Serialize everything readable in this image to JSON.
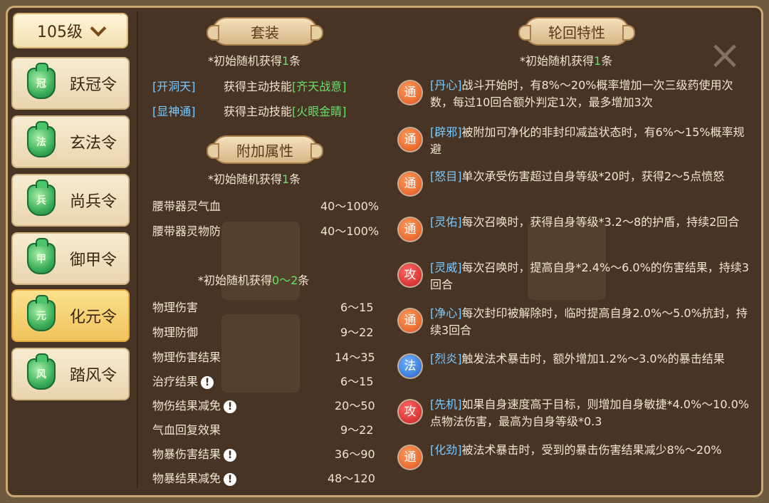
{
  "level_select": {
    "value": "105级"
  },
  "tokens": [
    {
      "label": "跃冠令",
      "glyph": "冠",
      "selected": false
    },
    {
      "label": "玄法令",
      "glyph": "法",
      "selected": false
    },
    {
      "label": "尚兵令",
      "glyph": "兵",
      "selected": false
    },
    {
      "label": "御甲令",
      "glyph": "甲",
      "selected": false
    },
    {
      "label": "化元令",
      "glyph": "元",
      "selected": true
    },
    {
      "label": "踏风令",
      "glyph": "风",
      "selected": false
    }
  ],
  "set": {
    "title": "套装",
    "note_prefix": "*初始随机获得",
    "note_count": "1",
    "note_suffix": "条",
    "rows": [
      {
        "tag": "[开洞天]",
        "desc": "获得主动技能",
        "skill": "[齐天战意]"
      },
      {
        "tag": "[显神通]",
        "desc": "获得主动技能",
        "skill": "[火眼金睛]"
      }
    ]
  },
  "extra": {
    "title": "附加属性",
    "note_prefix": "*初始随机获得",
    "note_count": "1",
    "note_suffix": "条",
    "rows": [
      {
        "name": "腰带器灵气血",
        "range": "40～100%"
      },
      {
        "name": "腰带器灵物防",
        "range": "40～100%"
      }
    ]
  },
  "random": {
    "note_prefix": "*初始随机获得",
    "note_count": "0～2",
    "note_suffix": "条",
    "rows": [
      {
        "name": "物理伤害",
        "range": "6～15",
        "warn": false
      },
      {
        "name": "物理防御",
        "range": "9～22",
        "warn": false
      },
      {
        "name": "物理伤害结果",
        "range": "14～35",
        "warn": false
      },
      {
        "name": "治疗结果",
        "range": "6～15",
        "warn": true
      },
      {
        "name": "物伤结果减免",
        "range": "20～50",
        "warn": true
      },
      {
        "name": "气血回复效果",
        "range": "9～22",
        "warn": false
      },
      {
        "name": "物暴伤害结果",
        "range": "36～90",
        "warn": true
      },
      {
        "name": "物暴结果减免",
        "range": "48～120",
        "warn": true
      }
    ]
  },
  "rebirth": {
    "title": "轮回特性",
    "note_prefix": "*初始随机获得",
    "note_count": "1",
    "note_suffix": "条",
    "traits": [
      {
        "badge": "通",
        "color": "orange",
        "name": "[丹心]",
        "text": "战斗开始时，有8%～20%概率增加一次三级药使用次数，每过10回合额外判定1次，最多增加3次"
      },
      {
        "badge": "通",
        "color": "orange",
        "name": "[辟邪]",
        "text": "被附加可净化的非封印减益状态时，有6%～15%概率规避"
      },
      {
        "badge": "通",
        "color": "orange",
        "name": "[怒目]",
        "text": "单次承受伤害超过自身等级*20时，获得2～5点愤怒"
      },
      {
        "badge": "通",
        "color": "orange",
        "name": "[灵佑]",
        "text": "每次召唤时，获得自身等级*3.2～8的护盾，持续2回合"
      },
      {
        "badge": "攻",
        "color": "red",
        "name": "[灵威]",
        "text": "每次召唤时，提高自身*2.4%～6.0%的伤害结果，持续3回合"
      },
      {
        "badge": "通",
        "color": "orange",
        "name": "[净心]",
        "text": "每次封印被解除时，临时提高自身2.0%～5.0%抗封，持续3回合"
      },
      {
        "badge": "法",
        "color": "blue",
        "name": "[烈炎]",
        "text": "触发法术暴击时，额外增加1.2%～3.0%的暴击结果"
      },
      {
        "badge": "攻",
        "color": "red",
        "name": "[先机]",
        "text": "如果自身速度高于目标，则增加自身敏捷*4.0%～10.0%点物法伤害，最高为自身等级*0.3"
      },
      {
        "badge": "通",
        "color": "orange",
        "name": "[化劲]",
        "text": "被法术暴击时，受到的暴击伤害结果减少8%～20%"
      }
    ]
  },
  "icons": {
    "close": "close-icon",
    "chevron": "chevron-down-icon",
    "warn": "warning-icon"
  }
}
